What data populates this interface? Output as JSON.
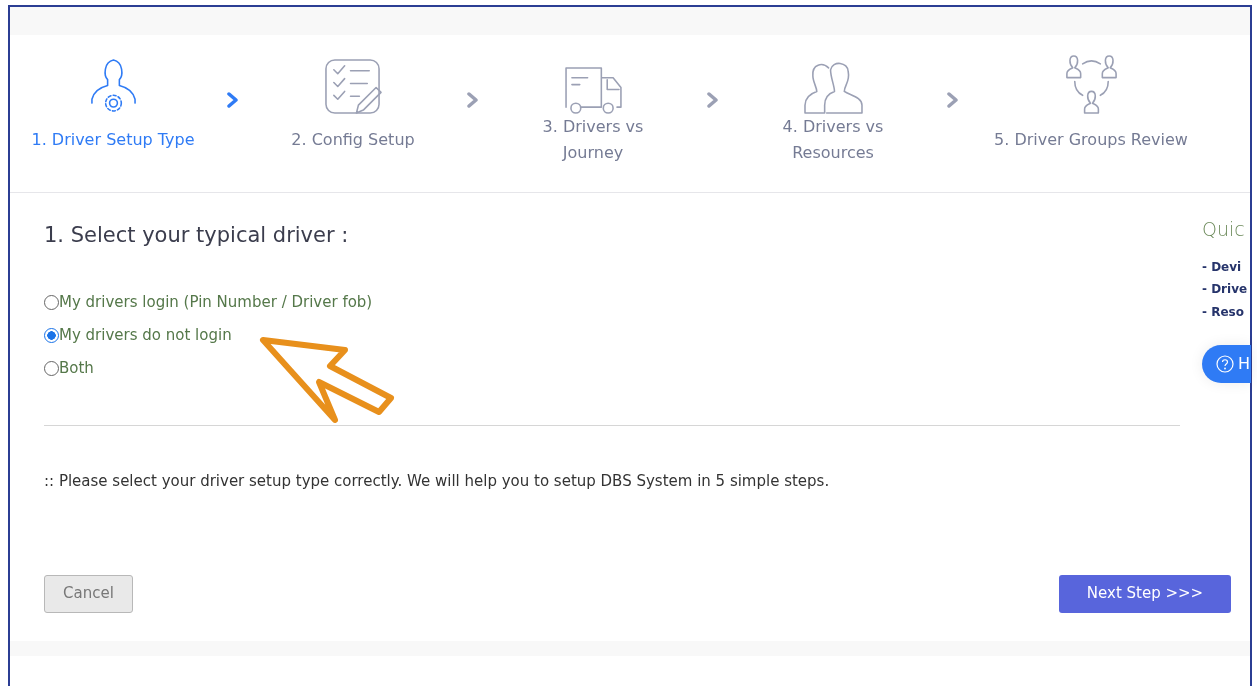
{
  "steps": [
    {
      "label": "1. Driver Setup Type",
      "selected": true
    },
    {
      "label": "2. Config Setup",
      "selected": false
    },
    {
      "label": "3. Drivers vs Journey",
      "selected": false
    },
    {
      "label": "4. Drivers vs Resources",
      "selected": false
    },
    {
      "label": "5. Driver Groups Review",
      "selected": false
    }
  ],
  "question": {
    "title": "1. Select your typical driver :",
    "options": [
      {
        "label": "My drivers login (Pin Number / Driver fob)",
        "selected": false
      },
      {
        "label": "My drivers do not login",
        "selected": true
      },
      {
        "label": "Both",
        "selected": false
      }
    ]
  },
  "note": ":: Please select your driver setup type correctly. We will help you to setup DBS System in 5 simple steps.",
  "quick_panel": {
    "title": "Quic",
    "items": [
      "- Devi",
      "- Drive",
      "- Reso"
    ],
    "help_button": "H"
  },
  "buttons": {
    "cancel": "Cancel",
    "next": "Next Step >>>"
  }
}
